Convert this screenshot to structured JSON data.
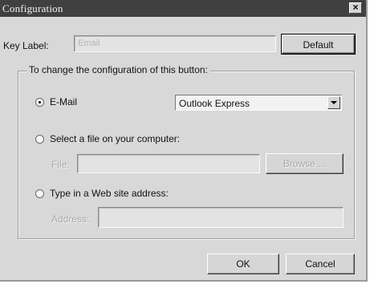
{
  "window": {
    "title": "Configuration",
    "close_symbol": "×"
  },
  "key_label": {
    "label": "Key Label:",
    "value": "Email",
    "default_button": "Default"
  },
  "group": {
    "legend": "To change the configuration of this button:",
    "options": [
      {
        "label": "E-Mail",
        "selected": true
      },
      {
        "label": "Select a file on your computer:",
        "selected": false
      },
      {
        "label": "Type in a Web site address:",
        "selected": false
      }
    ],
    "email_client": "Outlook Express",
    "file_label": "File:",
    "file_value": "",
    "browse_button": "Browse ...",
    "address_label": "Address:",
    "address_value": ""
  },
  "footer": {
    "ok_button": "OK",
    "cancel_button": "Cancel"
  }
}
